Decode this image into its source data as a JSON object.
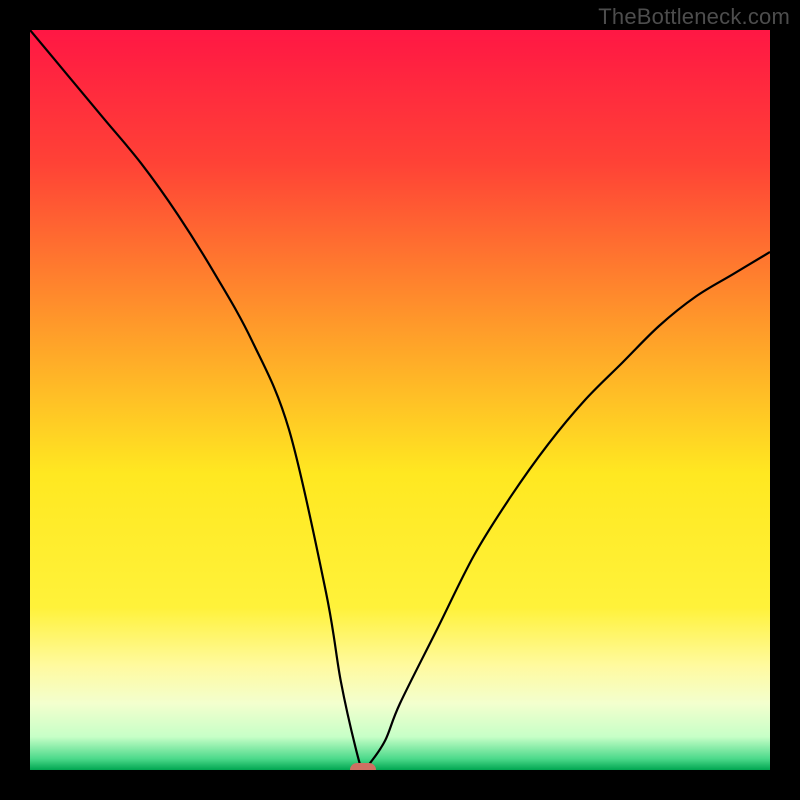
{
  "watermark": "TheBottleneck.com",
  "chart_data": {
    "type": "line",
    "title": "",
    "xlabel": "",
    "ylabel": "",
    "xlim": [
      0,
      100
    ],
    "ylim": [
      0,
      100
    ],
    "grid": false,
    "series": [
      {
        "name": "bottleneck-curve",
        "x": [
          0,
          5,
          10,
          15,
          20,
          25,
          30,
          35,
          40,
          42,
          44,
          45,
          46,
          48,
          50,
          55,
          60,
          65,
          70,
          75,
          80,
          85,
          90,
          95,
          100
        ],
        "y": [
          100,
          94,
          88,
          82,
          75,
          67,
          58,
          46,
          24,
          12,
          3,
          0,
          1,
          4,
          9,
          19,
          29,
          37,
          44,
          50,
          55,
          60,
          64,
          67,
          70
        ]
      }
    ],
    "background_gradient": {
      "stops": [
        {
          "pos": 0.0,
          "color": "#ff1744"
        },
        {
          "pos": 0.18,
          "color": "#ff4236"
        },
        {
          "pos": 0.4,
          "color": "#ff9a2a"
        },
        {
          "pos": 0.6,
          "color": "#ffe821"
        },
        {
          "pos": 0.78,
          "color": "#fff23a"
        },
        {
          "pos": 0.86,
          "color": "#fffaa0"
        },
        {
          "pos": 0.91,
          "color": "#f3ffce"
        },
        {
          "pos": 0.955,
          "color": "#c7ffc7"
        },
        {
          "pos": 0.985,
          "color": "#4bd98a"
        },
        {
          "pos": 1.0,
          "color": "#00a651"
        }
      ]
    },
    "marker": {
      "x": 45,
      "y": 0,
      "color": "#cf7062"
    }
  }
}
